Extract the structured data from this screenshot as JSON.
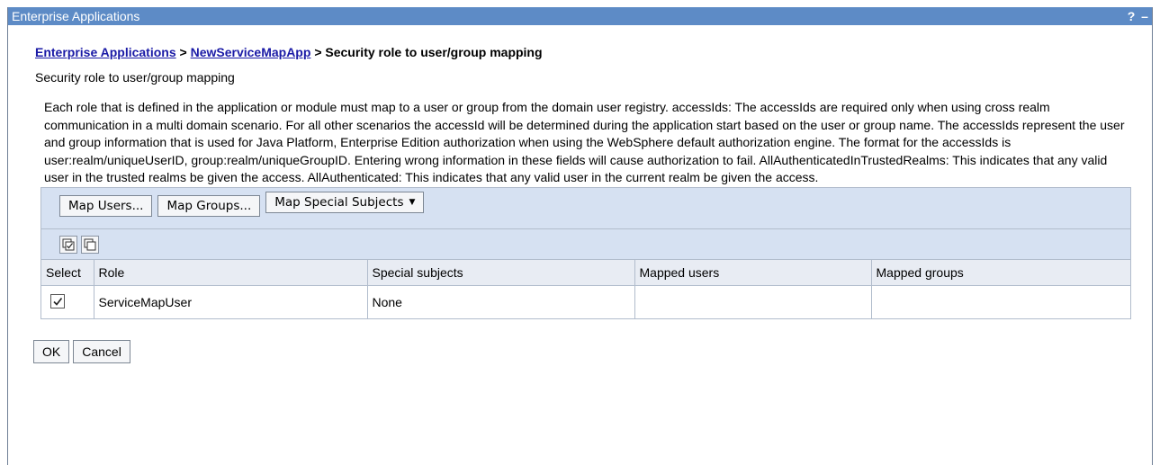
{
  "window": {
    "title": "Enterprise Applications",
    "help_label": "?",
    "minimize_label": "–"
  },
  "breadcrumb": {
    "link1": "Enterprise Applications",
    "sep1": ">",
    "link2": "NewServiceMapApp",
    "sep2": ">",
    "current": "Security role to user/group mapping"
  },
  "subtitle": "Security role to user/group mapping",
  "description": "Each role that is defined in the application or module must map to a user or group from the domain user registry. accessIds: The accessIds are required only when using cross realm communication in a multi domain scenario. For all other scenarios the accessId will be determined during the application start based on the user or group name. The accessIds represent the user and group information that is used for Java Platform, Enterprise Edition authorization when using the WebSphere default authorization engine. The format for the accessIds is user:realm/uniqueUserID, group:realm/uniqueGroupID. Entering wrong information in these fields will cause authorization to fail. AllAuthenticatedInTrustedRealms: This indicates that any valid user in the trusted realms be given the access. AllAuthenticated: This indicates that any valid user in the current realm be given the access.",
  "toolbar": {
    "map_users": "Map Users...",
    "map_groups": "Map Groups...",
    "map_special": "Map Special Subjects"
  },
  "icons": {
    "select_all": "select-all-icon",
    "deselect_all": "deselect-all-icon"
  },
  "table": {
    "columns": [
      "Select",
      "Role",
      "Special subjects",
      "Mapped users",
      "Mapped groups"
    ],
    "rows": [
      {
        "checked": true,
        "role": "ServiceMapUser",
        "special_subjects": "None",
        "mapped_users": "",
        "mapped_groups": ""
      }
    ]
  },
  "actions": {
    "ok": "OK",
    "cancel": "Cancel"
  },
  "colors": {
    "titlebar": "#5d8bc6",
    "toolbar_bg": "#d6e1f2",
    "header_bg": "#e8ecf3",
    "link": "#1a1aa6"
  }
}
